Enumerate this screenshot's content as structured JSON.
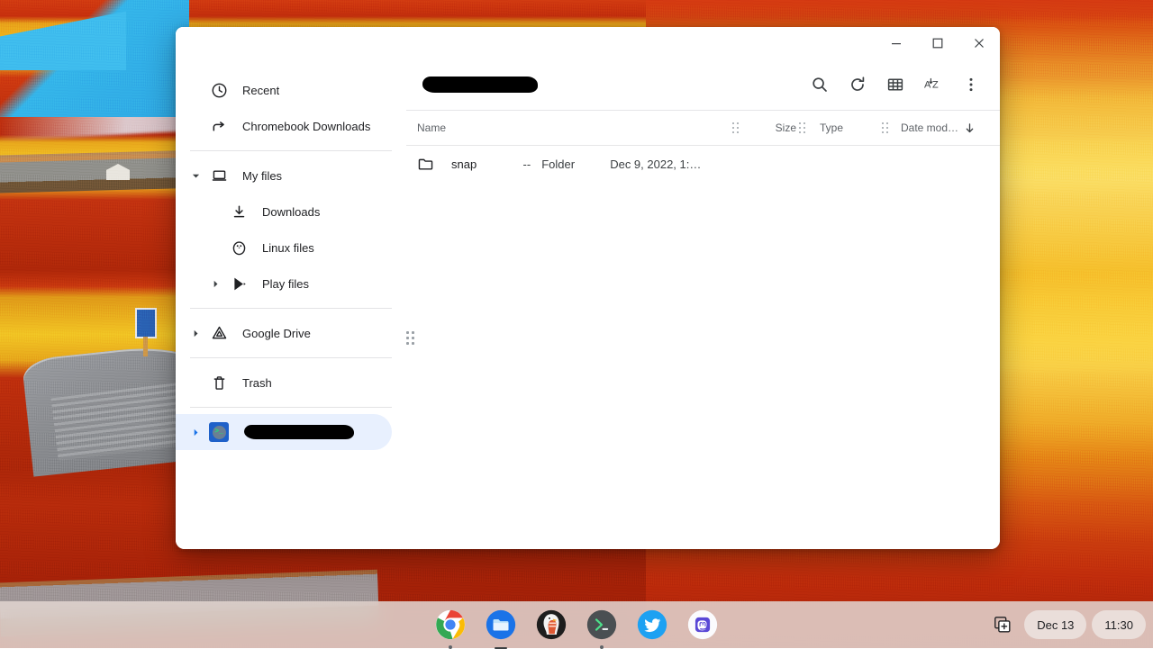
{
  "desktop": {
    "wallpaper_name": "red-salt-marsh-boardwalk-wallpaper",
    "colors": {
      "field_red": "#c0300c",
      "field_yellow": "#f3c522",
      "water_cyan": "#3fbdee",
      "shelf": "#e2d6d2"
    }
  },
  "window": {
    "app": "Files",
    "controls": {
      "minimize": "minimize-window",
      "maximize": "maximize-window",
      "close": "close-window"
    }
  },
  "sidebar": {
    "items": [
      {
        "label": "Recent",
        "icon": "clock-icon",
        "twisty": "none",
        "indent": false,
        "selected": false,
        "redacted": false
      },
      {
        "label": "Chromebook Downloads",
        "icon": "share-arrow-icon",
        "twisty": "none",
        "indent": false,
        "selected": false,
        "redacted": false
      },
      {
        "label": "My files",
        "icon": "laptop-icon",
        "twisty": "expanded",
        "indent": false,
        "selected": false,
        "redacted": false
      },
      {
        "label": "Downloads",
        "icon": "download-icon",
        "twisty": "none",
        "indent": true,
        "selected": false,
        "redacted": false
      },
      {
        "label": "Linux files",
        "icon": "penguin-icon",
        "twisty": "none",
        "indent": true,
        "selected": false,
        "redacted": false
      },
      {
        "label": "Play files",
        "icon": "play-store-icon",
        "twisty": "collapsed",
        "indent": true,
        "selected": false,
        "redacted": false
      },
      {
        "label": "Google Drive",
        "icon": "google-drive-icon",
        "twisty": "collapsed",
        "indent": false,
        "selected": false,
        "redacted": false
      },
      {
        "label": "Trash",
        "icon": "trash-icon",
        "twisty": "none",
        "indent": false,
        "selected": false,
        "redacted": false
      },
      {
        "label": "",
        "icon": "terminal-app-icon",
        "twisty": "collapsed",
        "indent": false,
        "selected": true,
        "redacted": true
      }
    ],
    "separator_after": [
      1,
      5,
      6,
      7
    ],
    "resize_handle": "sidebar-resize-grip"
  },
  "toolbar": {
    "breadcrumb_redacted": true,
    "buttons": [
      {
        "name": "search-button",
        "icon": "search-icon",
        "label": "Search"
      },
      {
        "name": "refresh-button",
        "icon": "refresh-icon",
        "label": "Refresh"
      },
      {
        "name": "view-toggle-button",
        "icon": "grid-view-icon",
        "label": "Switch to grid view"
      },
      {
        "name": "sort-button",
        "icon": "sort-az-icon",
        "label": "Sort"
      },
      {
        "name": "more-options-button",
        "icon": "three-dot-menu-icon",
        "label": "More…"
      }
    ]
  },
  "file_list": {
    "columns": [
      {
        "key": "name",
        "label": "Name"
      },
      {
        "key": "size",
        "label": "Size"
      },
      {
        "key": "type",
        "label": "Type"
      },
      {
        "key": "date",
        "label": "Date mod…",
        "sorted": "descending"
      }
    ],
    "rows": [
      {
        "name": "snap",
        "icon": "folder-icon",
        "size": "--",
        "type": "Folder",
        "date": "Dec 9, 2022, 1:…"
      }
    ]
  },
  "shelf": {
    "apps": [
      {
        "name": "chrome",
        "label": "Google Chrome",
        "indicator": "dot"
      },
      {
        "name": "files",
        "label": "Files",
        "indicator": "active"
      },
      {
        "name": "duckduckgo",
        "label": "DuckDuckGo",
        "indicator": "none"
      },
      {
        "name": "terminal",
        "label": "Terminal",
        "indicator": "dot"
      },
      {
        "name": "twitter",
        "label": "Twitter",
        "indicator": "none"
      },
      {
        "name": "mastodon",
        "label": "Mastodon",
        "indicator": "none"
      }
    ],
    "status": {
      "capture_icon": "screen-capture-icon",
      "date": "Dec 13",
      "time": "11:30"
    }
  }
}
